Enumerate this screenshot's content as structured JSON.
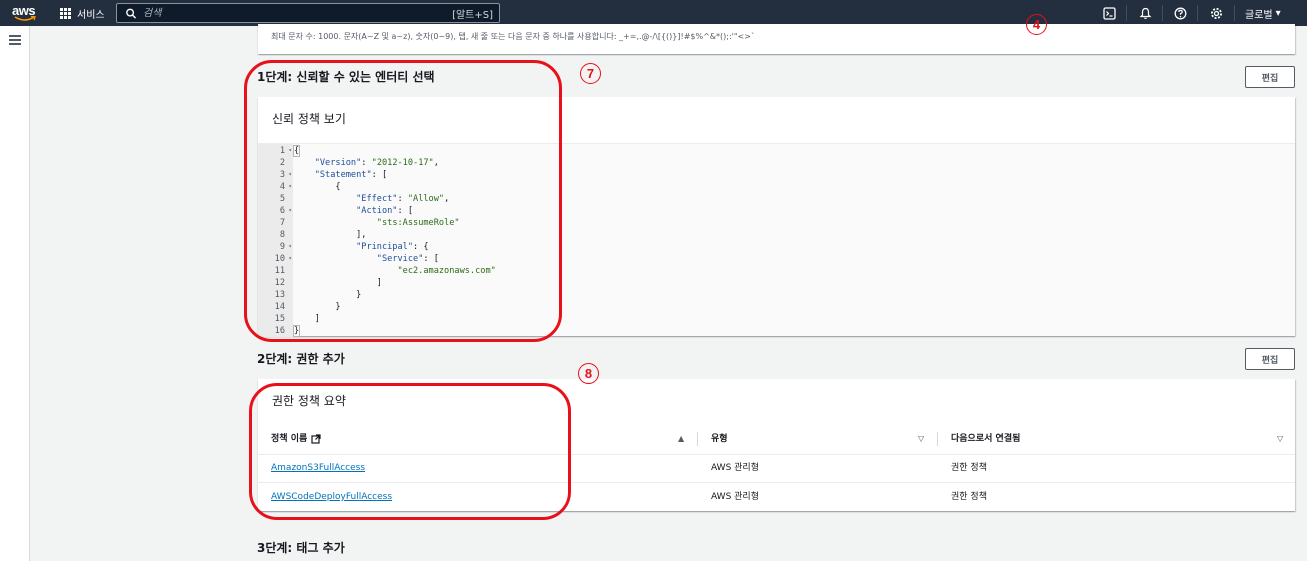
{
  "topnav": {
    "logo": "aws",
    "services_label": "서비스",
    "search_placeholder": "검색",
    "search_shortcut": "[알트+S]",
    "region_label": "글로벌",
    "region_caret": "▾",
    "icons": [
      "cloudshell-icon",
      "notifications-icon",
      "help-icon",
      "settings-icon"
    ]
  },
  "hint_text": "최대 문자 수: 1000. 문자(A~Z 및 a~z), 숫자(0~9), 탭, 새 줄 또는 다음 문자 중 하나를 사용합니다: _+=,.@-/\\[{()}]!#$%^&*();:'\"<>`",
  "step1": {
    "title": "1단계: 신뢰할 수 있는 엔터티 선택",
    "edit_label": "편집",
    "panel_heading": "신뢰 정책 보기",
    "code_lines": [
      {
        "n": "1",
        "fold": true,
        "text": "{"
      },
      {
        "n": "2",
        "fold": false,
        "text": "    \"Version\": \"2012-10-17\","
      },
      {
        "n": "3",
        "fold": true,
        "text": "    \"Statement\": ["
      },
      {
        "n": "4",
        "fold": true,
        "text": "        {"
      },
      {
        "n": "5",
        "fold": false,
        "text": "            \"Effect\": \"Allow\","
      },
      {
        "n": "6",
        "fold": true,
        "text": "            \"Action\": ["
      },
      {
        "n": "7",
        "fold": false,
        "text": "                \"sts:AssumeRole\""
      },
      {
        "n": "8",
        "fold": false,
        "text": "            ],"
      },
      {
        "n": "9",
        "fold": true,
        "text": "            \"Principal\": {"
      },
      {
        "n": "10",
        "fold": true,
        "text": "                \"Service\": ["
      },
      {
        "n": "11",
        "fold": false,
        "text": "                    \"ec2.amazonaws.com\""
      },
      {
        "n": "12",
        "fold": false,
        "text": "                ]"
      },
      {
        "n": "13",
        "fold": false,
        "text": "            }"
      },
      {
        "n": "14",
        "fold": false,
        "text": "        }"
      },
      {
        "n": "15",
        "fold": false,
        "text": "    ]"
      },
      {
        "n": "16",
        "fold": false,
        "text": "}"
      }
    ]
  },
  "step2": {
    "title": "2단계: 권한 추가",
    "edit_label": "편집",
    "panel_heading": "권한 정책 요약",
    "columns": [
      "정책 이름",
      "유형",
      "다음으로서 연결됨"
    ],
    "sort_icons": [
      "▲",
      "▽",
      "▽"
    ],
    "rows": [
      {
        "name": "AmazonS3FullAccess",
        "type": "AWS 관리형",
        "attached_as": "권한 정책"
      },
      {
        "name": "AWSCodeDeployFullAccess",
        "type": "AWS 관리형",
        "attached_as": "권한 정책"
      }
    ]
  },
  "step3": {
    "title": "3단계: 태그 추가"
  },
  "annotations": {
    "marker_4": "4",
    "marker_7": "7",
    "marker_8": "8",
    "color": "#e8101a"
  }
}
